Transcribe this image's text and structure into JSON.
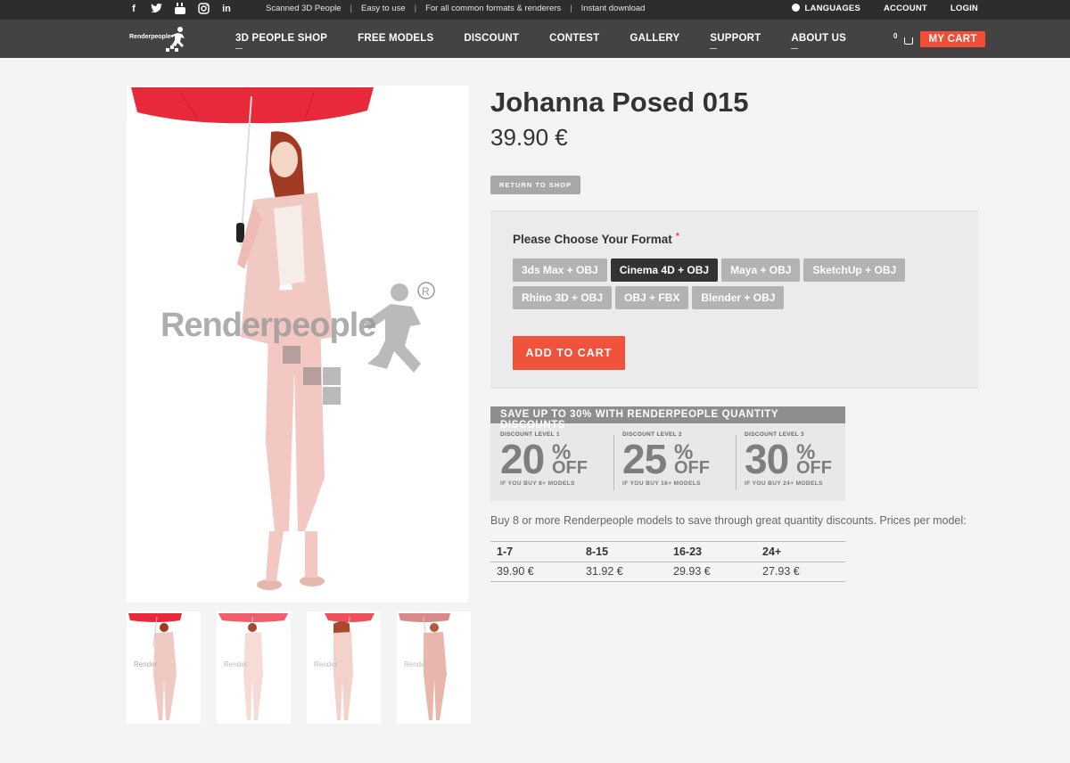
{
  "topbar": {
    "social": [
      "facebook-icon",
      "twitter-icon",
      "youtube-icon",
      "instagram-icon",
      "linkedin-icon"
    ],
    "taglines": [
      "Scanned 3D People",
      "Easy to use",
      "For all common formats & renderers",
      "Instant download"
    ],
    "separator": "|",
    "languages": "LANGUAGES",
    "account": "ACCOUNT",
    "login": "LOGIN"
  },
  "nav": {
    "logo_text": "Renderpeople",
    "items": [
      "3D PEOPLE SHOP",
      "FREE MODELS",
      "DISCOUNT",
      "CONTEST",
      "GALLERY",
      "SUPPORT",
      "ABOUT US"
    ],
    "cart_count": "0",
    "my_cart": "MY CART"
  },
  "product": {
    "title": "Johanna Posed 015",
    "price": "39.90 €",
    "return_label": "RETURN TO SHOP",
    "watermark": "Renderpeople"
  },
  "formats": {
    "label": "Please Choose Your Format",
    "required_mark": "*",
    "options": [
      "3ds Max + OBJ",
      "Cinema 4D + OBJ",
      "Maya + OBJ",
      "SketchUp + OBJ",
      "Rhino 3D + OBJ",
      "OBJ + FBX",
      "Blender + OBJ"
    ],
    "selected": "Cinema 4D + OBJ",
    "add_to_cart": "ADD TO CART"
  },
  "banner": {
    "headline": "SAVE UP TO 30% WITH RENDERPEOPLE QUANTITY DISCOUNTS",
    "levels": [
      {
        "level": "DISCOUNT LEVEL 1",
        "value": "20",
        "pct": "%",
        "off": "OFF",
        "sub": "IF YOU BUY 8+ MODELS"
      },
      {
        "level": "DISCOUNT LEVEL 2",
        "value": "25",
        "pct": "%",
        "off": "OFF",
        "sub": "IF YOU BUY 16+ MODELS"
      },
      {
        "level": "DISCOUNT LEVEL 3",
        "value": "30",
        "pct": "%",
        "off": "OFF",
        "sub": "IF YOU BUY 24+ MODELS"
      }
    ]
  },
  "discount_text": "Buy 8 or more Renderpeople models to save through great quantity discounts. Prices per model:",
  "price_table": {
    "headers": [
      "1-7",
      "8-15",
      "16-23",
      "24+"
    ],
    "values": [
      "39.90 €",
      "31.92 €",
      "29.93 €",
      "27.93 €"
    ]
  },
  "colors": {
    "accent": "#f04e36",
    "topbar": "#2d2d2d",
    "navbar": "#434343",
    "umbrella": "#e8293a",
    "outfit": "#f0c4c0"
  }
}
